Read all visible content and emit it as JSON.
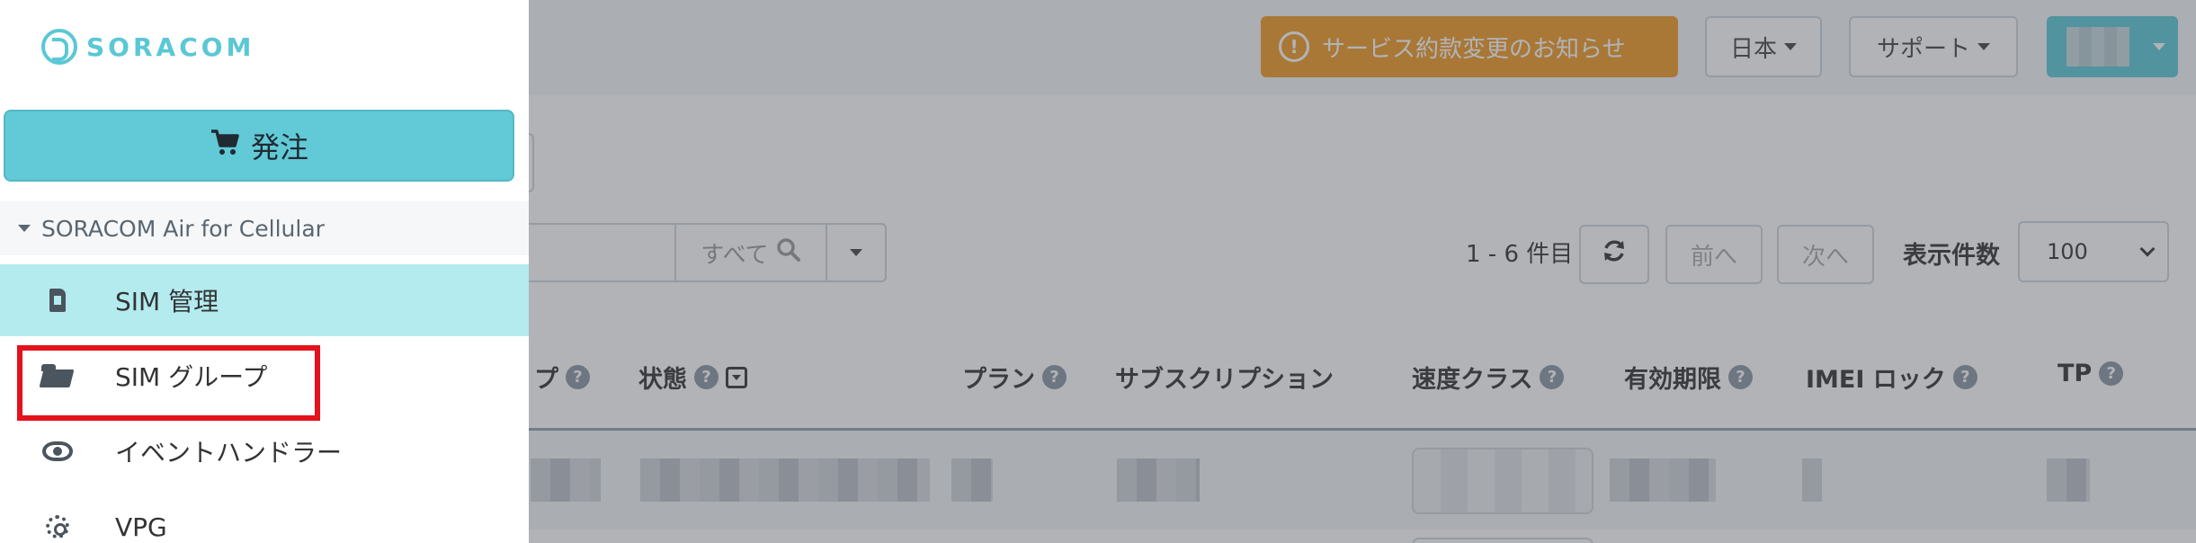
{
  "header": {
    "notice_label": "サービス約款変更のお知らせ",
    "language_label": "日本",
    "support_label": "サポート"
  },
  "toolbar": {
    "search_button_label": "すべて",
    "count_text": "1 - 6 件目",
    "prev_label": "前へ",
    "next_label": "次へ",
    "per_page_label": "表示件数",
    "per_page_value": "100"
  },
  "table": {
    "columns": [
      "プ",
      "状態",
      "プラン",
      "サブスクリプション",
      "速度クラス",
      "有効期限",
      "IMEI ロック",
      "TP"
    ]
  },
  "sidebar": {
    "logo_text": "SORACOM",
    "order_label": "発注",
    "section_label": "SORACOM Air for Cellular",
    "items": [
      {
        "label": "SIM 管理",
        "icon": "sim-card-icon",
        "active": true
      },
      {
        "label": "SIM グループ",
        "icon": "folder-open-icon",
        "active": false
      },
      {
        "label": "イベントハンドラー",
        "icon": "eye-icon",
        "active": false
      },
      {
        "label": "VPG",
        "icon": "vpg-icon",
        "active": false
      }
    ]
  },
  "colors": {
    "accent": "#62c9d6",
    "active_item": "#b3ebef",
    "notice": "#f19a22",
    "highlight": "#e3121b"
  }
}
